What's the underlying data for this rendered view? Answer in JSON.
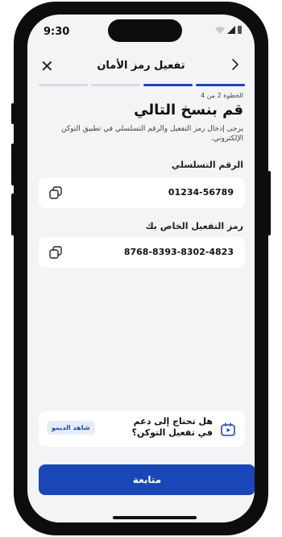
{
  "status": {
    "time": "9:30"
  },
  "nav": {
    "title": "تفعيل رمز الأمان",
    "close_label": "✕"
  },
  "progress": {
    "step": 2,
    "total": 4
  },
  "step_label": "الخطوة 2 من 4",
  "heading": "قم بنسخ التالي",
  "description": "يرجى إدخال رمز التفعيل والرقم التسلسلي في تطبيق التوكن الإلكتروني.",
  "serial": {
    "label": "الرقم التسلسلي",
    "value": "01234-56789"
  },
  "activation": {
    "label": "رمز التفعيل الخاص بك",
    "value": "8768-8393-8302-4823"
  },
  "help": {
    "text": "هل تحتاج إلى دعم في تفعيل التوكن؟",
    "demo_label": "شاهد الديمو"
  },
  "cta": {
    "label": "متابعة"
  },
  "colors": {
    "primary": "#1a47b8",
    "background": "#f3f4f6",
    "card": "#ffffff"
  },
  "icons": [
    "close-icon",
    "chevron-right-icon",
    "copy-icon",
    "video-icon",
    "wifi-icon",
    "signal-icon",
    "battery-icon"
  ]
}
